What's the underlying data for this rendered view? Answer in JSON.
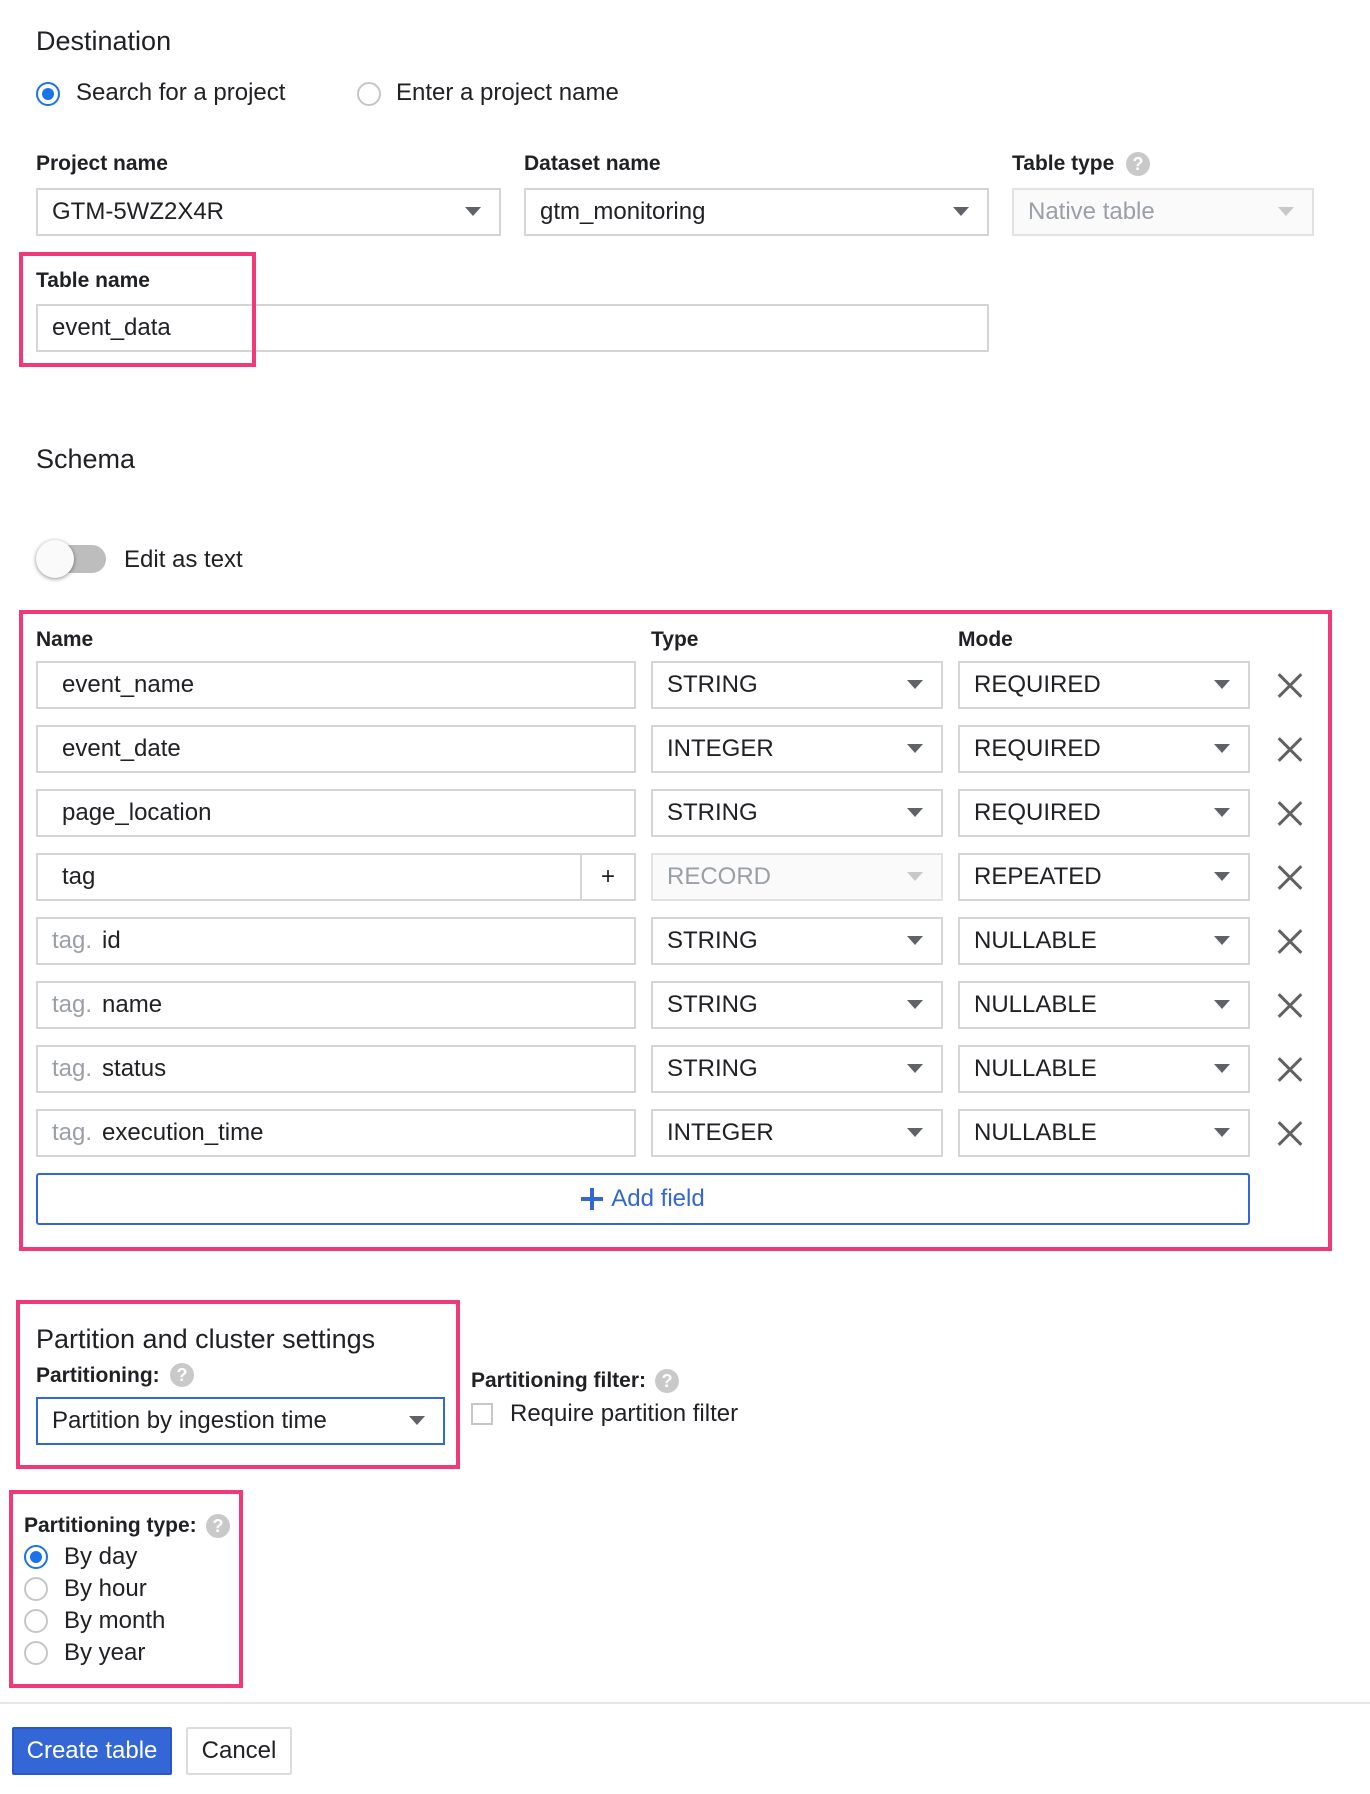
{
  "destination": {
    "title": "Destination",
    "radio_search": "Search for a project",
    "radio_enter": "Enter a project name",
    "selected": "Search for a project"
  },
  "fields": {
    "project_label": "Project name",
    "project_value": "GTM-5WZ2X4R",
    "dataset_label": "Dataset name",
    "dataset_value": "gtm_monitoring",
    "table_type_label": "Table type",
    "table_type_value": "Native table",
    "table_name_label": "Table name",
    "table_name_value": "event_data"
  },
  "schema": {
    "title": "Schema",
    "edit_as_text": "Edit as text",
    "edit_as_text_on": false,
    "col_name": "Name",
    "col_type": "Type",
    "col_mode": "Mode",
    "rows": [
      {
        "prefix": "",
        "name": "event_name",
        "type": "STRING",
        "mode": "REQUIRED"
      },
      {
        "prefix": "",
        "name": "event_date",
        "type": "INTEGER",
        "mode": "REQUIRED"
      },
      {
        "prefix": "",
        "name": "page_location",
        "type": "STRING",
        "mode": "REQUIRED"
      },
      {
        "prefix": "",
        "name": "tag",
        "type": "RECORD",
        "mode": "REPEATED",
        "plus": "+"
      },
      {
        "prefix": "tag.",
        "name": "id",
        "type": "STRING",
        "mode": "NULLABLE"
      },
      {
        "prefix": "tag.",
        "name": "name",
        "type": "STRING",
        "mode": "NULLABLE"
      },
      {
        "prefix": "tag.",
        "name": "status",
        "type": "STRING",
        "mode": "NULLABLE"
      },
      {
        "prefix": "tag.",
        "name": "execution_time",
        "type": "INTEGER",
        "mode": "NULLABLE"
      }
    ],
    "add_field": "Add field"
  },
  "partition": {
    "title": "Partition and cluster settings",
    "partitioning_label": "Partitioning:",
    "partitioning_value": "Partition by ingestion time",
    "filter_label": "Partitioning filter:",
    "require_filter": "Require partition filter",
    "type_label": "Partitioning type:",
    "options": [
      "By day",
      "By hour",
      "By month",
      "By year"
    ],
    "selected": "By day"
  },
  "actions": {
    "create": "Create table",
    "cancel": "Cancel"
  },
  "colors": {
    "accent": "#1a73e8",
    "highlight": "#f03a77",
    "button": "#3367d6"
  }
}
